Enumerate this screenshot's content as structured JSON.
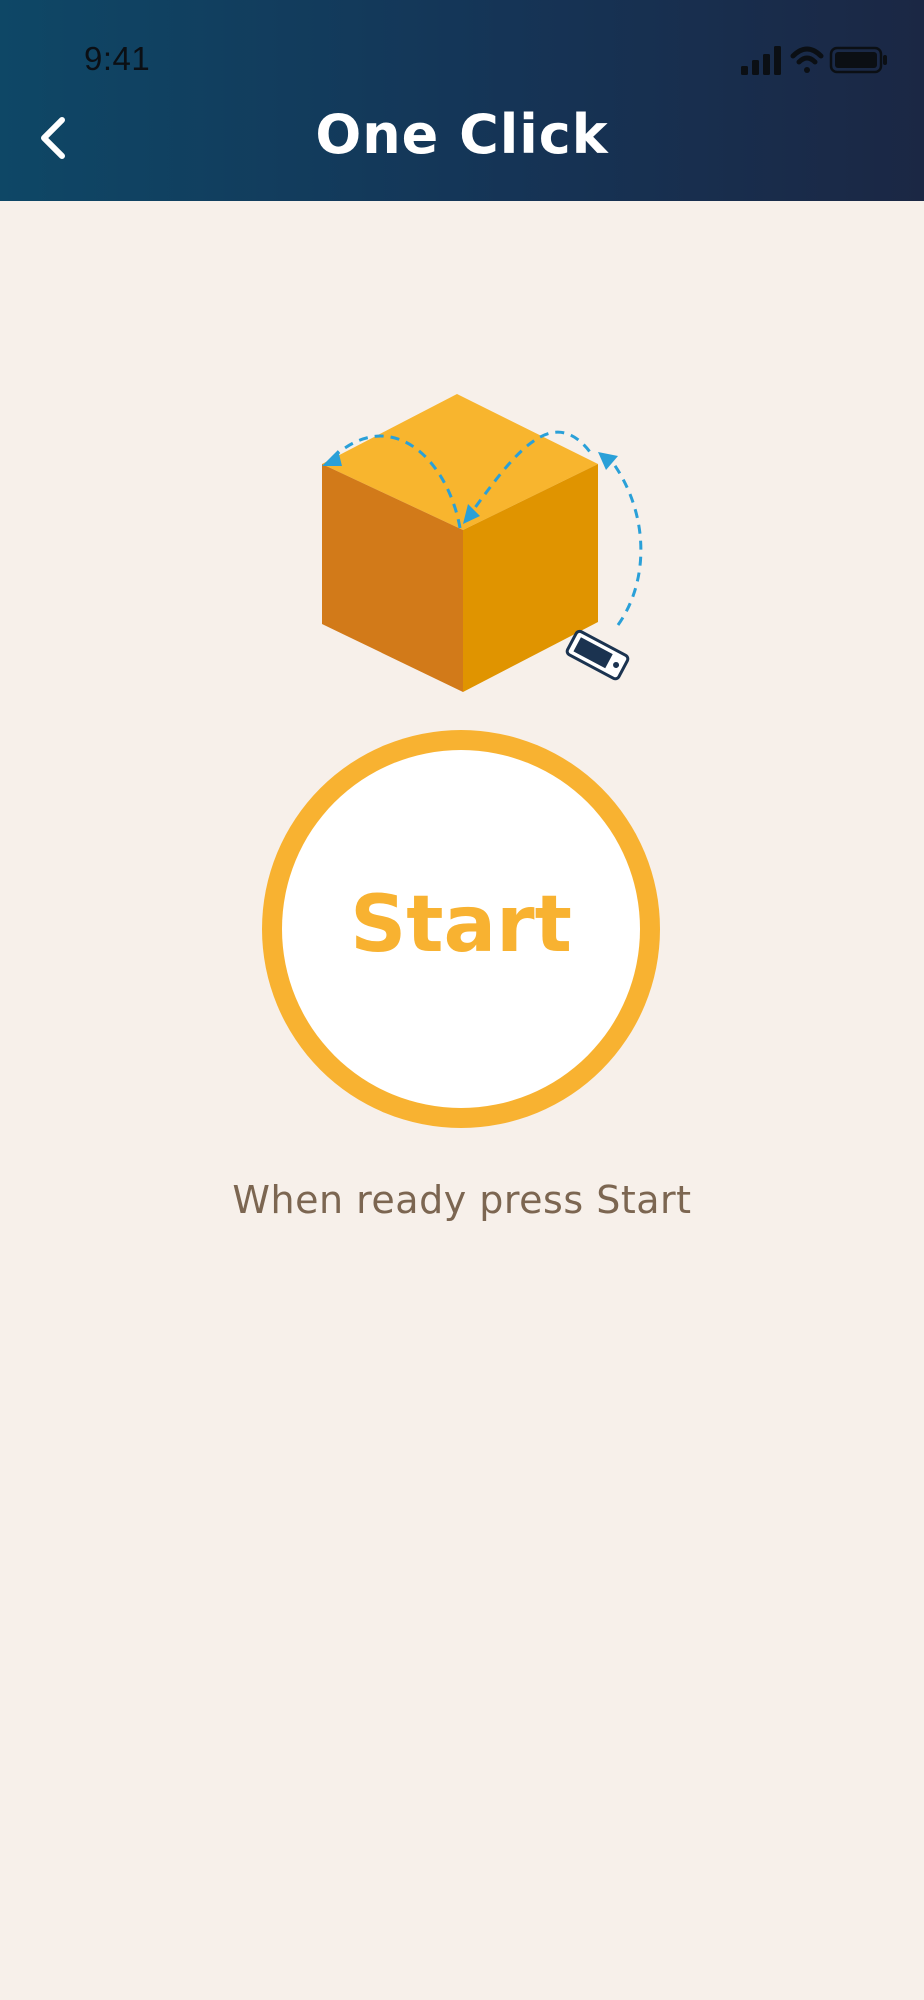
{
  "status_bar": {
    "time": "9:41",
    "icons": [
      "signal-icon",
      "wifi-icon",
      "battery-icon"
    ]
  },
  "header": {
    "title": "One Click",
    "back_icon": "chevron-left-icon"
  },
  "illustration": {
    "icon": "box-phone-scan-illustration"
  },
  "start_button": {
    "label": "Start"
  },
  "instruction": {
    "text": "When ready press Start"
  },
  "colors": {
    "header_gradient_start": "#0e4766",
    "header_gradient_end": "#1b2744",
    "background": "#f7f0ea",
    "accent": "#f8b231",
    "hint_text": "#7c6651",
    "arrow": "#2aa0d8"
  }
}
